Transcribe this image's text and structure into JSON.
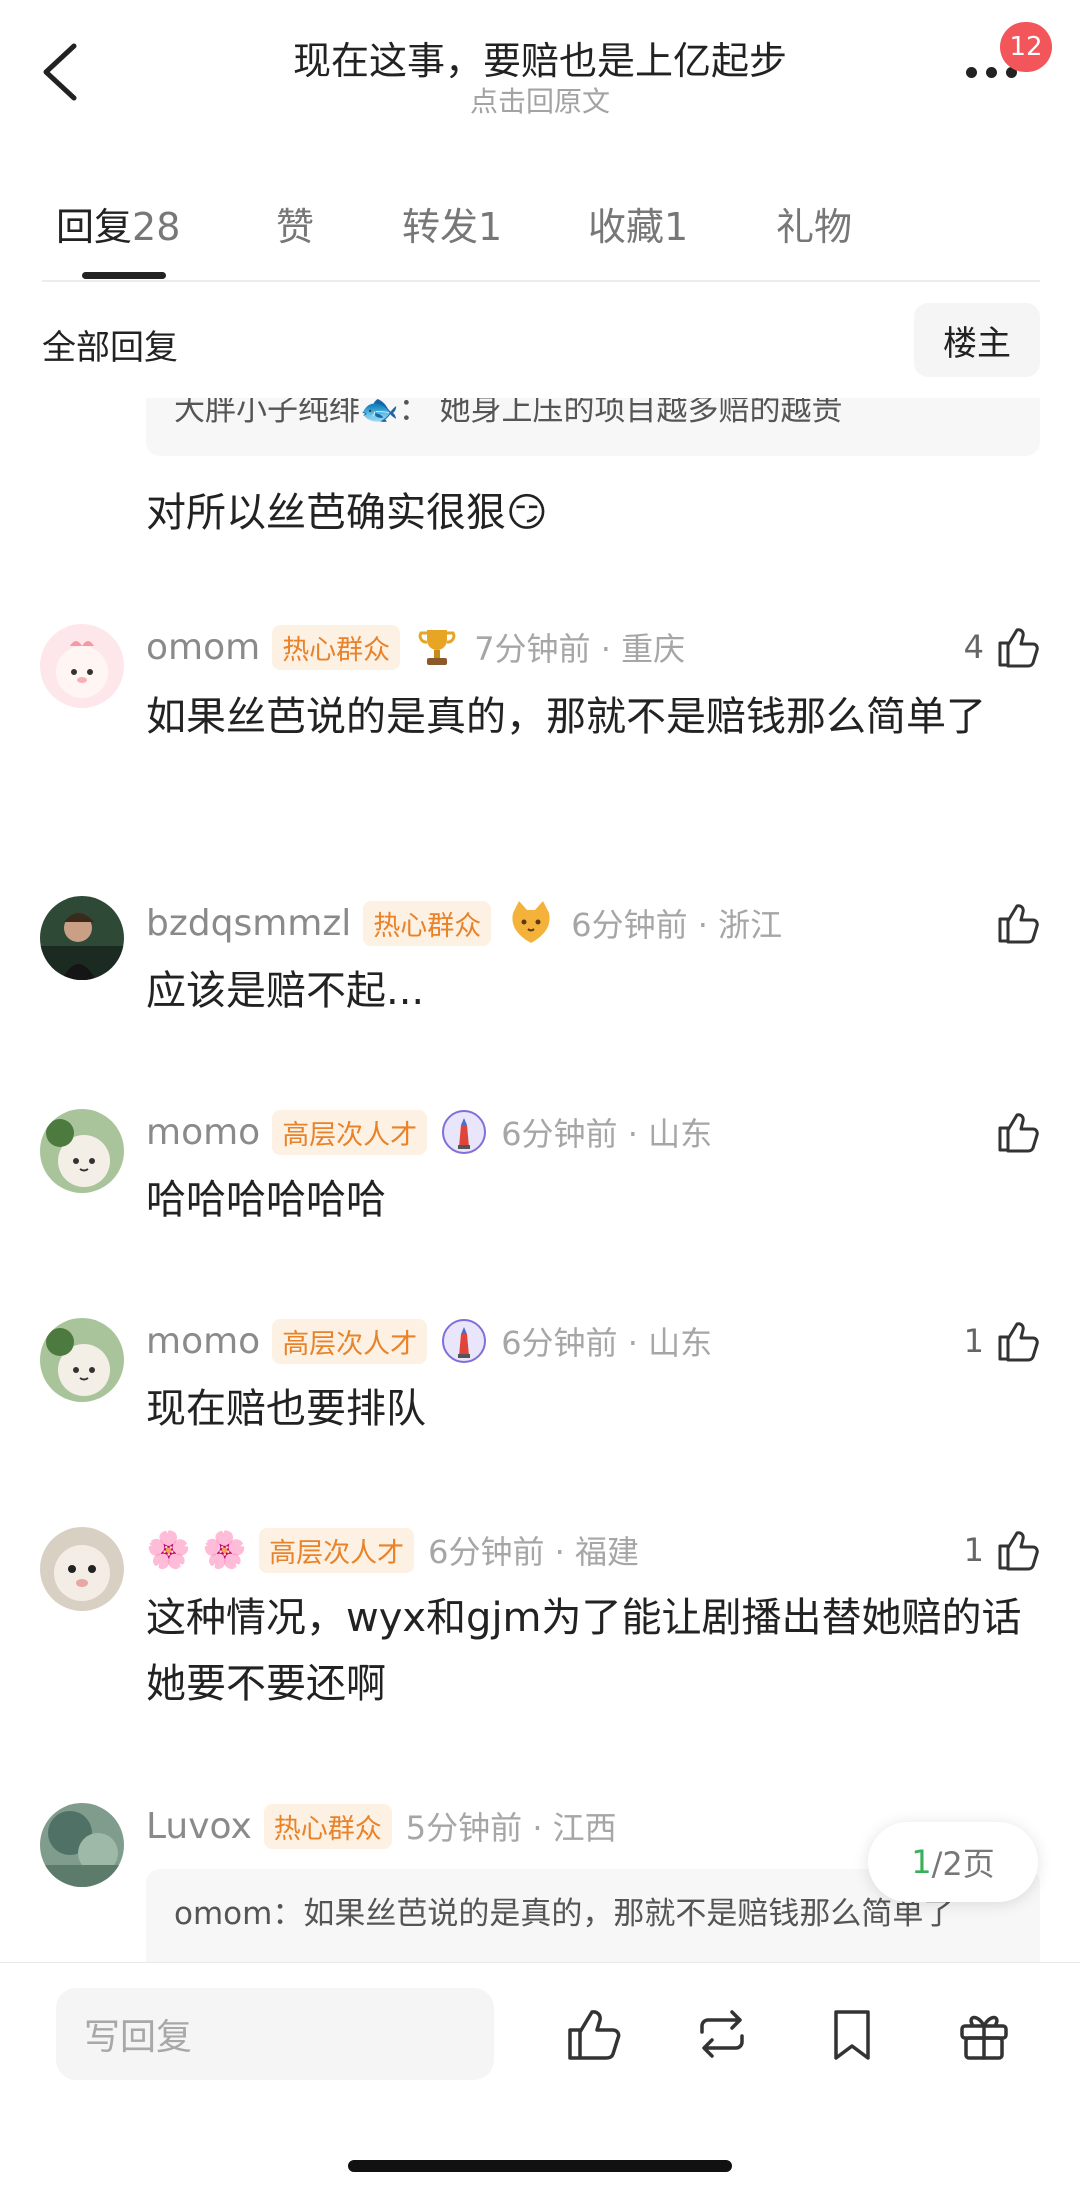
{
  "header": {
    "title": "现在这事，要赔也是上亿起步",
    "subtitle": "点击回原文",
    "badge": "12"
  },
  "tabs": [
    {
      "label": "回复",
      "count": "28"
    },
    {
      "label": "赞",
      "count": ""
    },
    {
      "label": "转发",
      "count": "1"
    },
    {
      "label": "收藏",
      "count": "1"
    },
    {
      "label": "礼物",
      "count": ""
    }
  ],
  "filter": {
    "all_replies": "全部回复",
    "owner": "楼主"
  },
  "top_quote": "大胖小子纯绯🐟：  她身上压的项目越多赔的越贵",
  "first_text": "对所以丝芭确实很狠😏",
  "comments": [
    {
      "name": "omom",
      "tag": "热心群众",
      "time": "7分钟前 · 重庆",
      "likes": "4",
      "text": "如果丝芭说的是真的，那就不是赔钱那么简单了"
    },
    {
      "name": "bzdqsmmzl",
      "tag": "热心群众",
      "time": "6分钟前 · 浙江",
      "likes": "",
      "text": "应该是赔不起..."
    },
    {
      "name": "momo",
      "tag": "高层次人才",
      "time": "6分钟前 · 山东",
      "likes": "",
      "text": "哈哈哈哈哈哈"
    },
    {
      "name": "momo",
      "tag": "高层次人才",
      "time": "6分钟前 · 山东",
      "likes": "1",
      "text": "现在赔也要排队"
    },
    {
      "name": "🌸 🌸",
      "tag": "高层次人才",
      "time": "6分钟前 · 福建",
      "likes": "1",
      "text": "这种情况，wyx和gjm为了能让剧播出替她赔的话她要不要还啊"
    },
    {
      "name": "Luvox",
      "tag": "热心群众",
      "time": "5分钟前 · 江西",
      "likes": "",
      "text": "",
      "quote": "omom：如果丝芭说的是真的，那就不是赔钱那么简单了"
    }
  ],
  "pager": {
    "current": "1",
    "total": "/2页"
  },
  "bottom": {
    "reply_placeholder": "写回复"
  },
  "icons": [
    "back-arrow-icon",
    "more-icon",
    "thumb-up-icon",
    "trophy-icon",
    "cat-icon",
    "lighthouse-icon",
    "repost-icon",
    "bookmark-icon",
    "gift-icon"
  ]
}
